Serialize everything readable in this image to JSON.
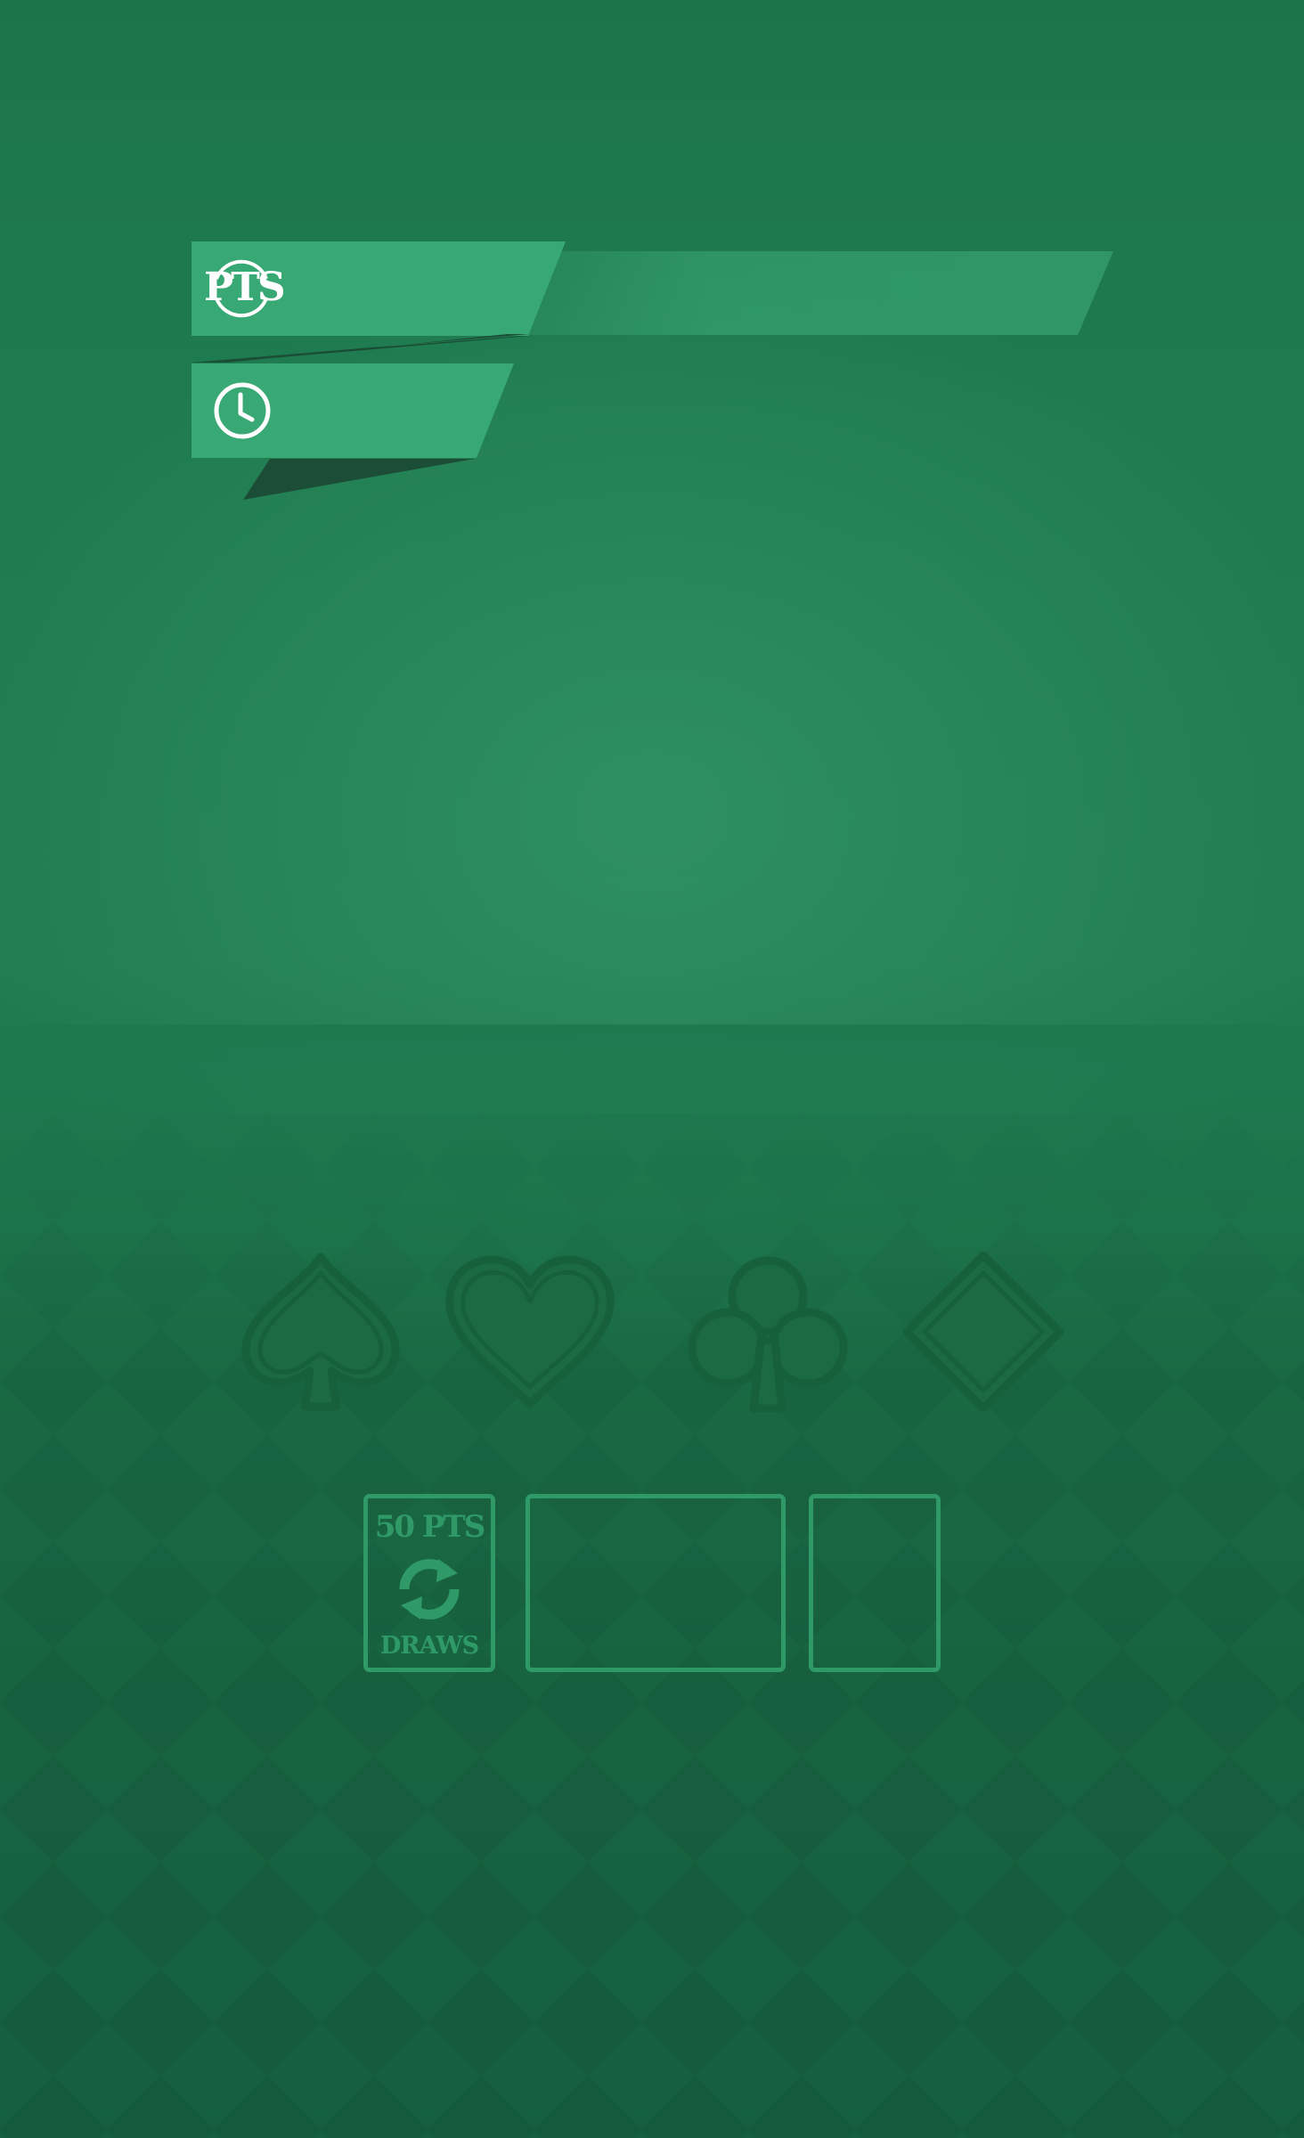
{
  "hud": {
    "score": {
      "icon": "pts-icon",
      "icon_label": "PTS",
      "value": ""
    },
    "timer": {
      "icon": "clock-icon",
      "value": ""
    }
  },
  "foundations": [
    {
      "suit": "spade",
      "icon": "spade-icon"
    },
    {
      "suit": "heart",
      "icon": "heart-icon"
    },
    {
      "suit": "club",
      "icon": "club-icon"
    },
    {
      "suit": "diamond",
      "icon": "diamond-icon"
    }
  ],
  "draw_pile": {
    "points_label": "50 PTS",
    "icon": "recycle-icon",
    "draws_label": "DRAWS"
  },
  "colors": {
    "felt": "#217d52",
    "ribbon": "#38a874",
    "ribbon_shadow": "#1b4a34",
    "outline": "#2f9a68",
    "suit_outline": "#19663f"
  }
}
